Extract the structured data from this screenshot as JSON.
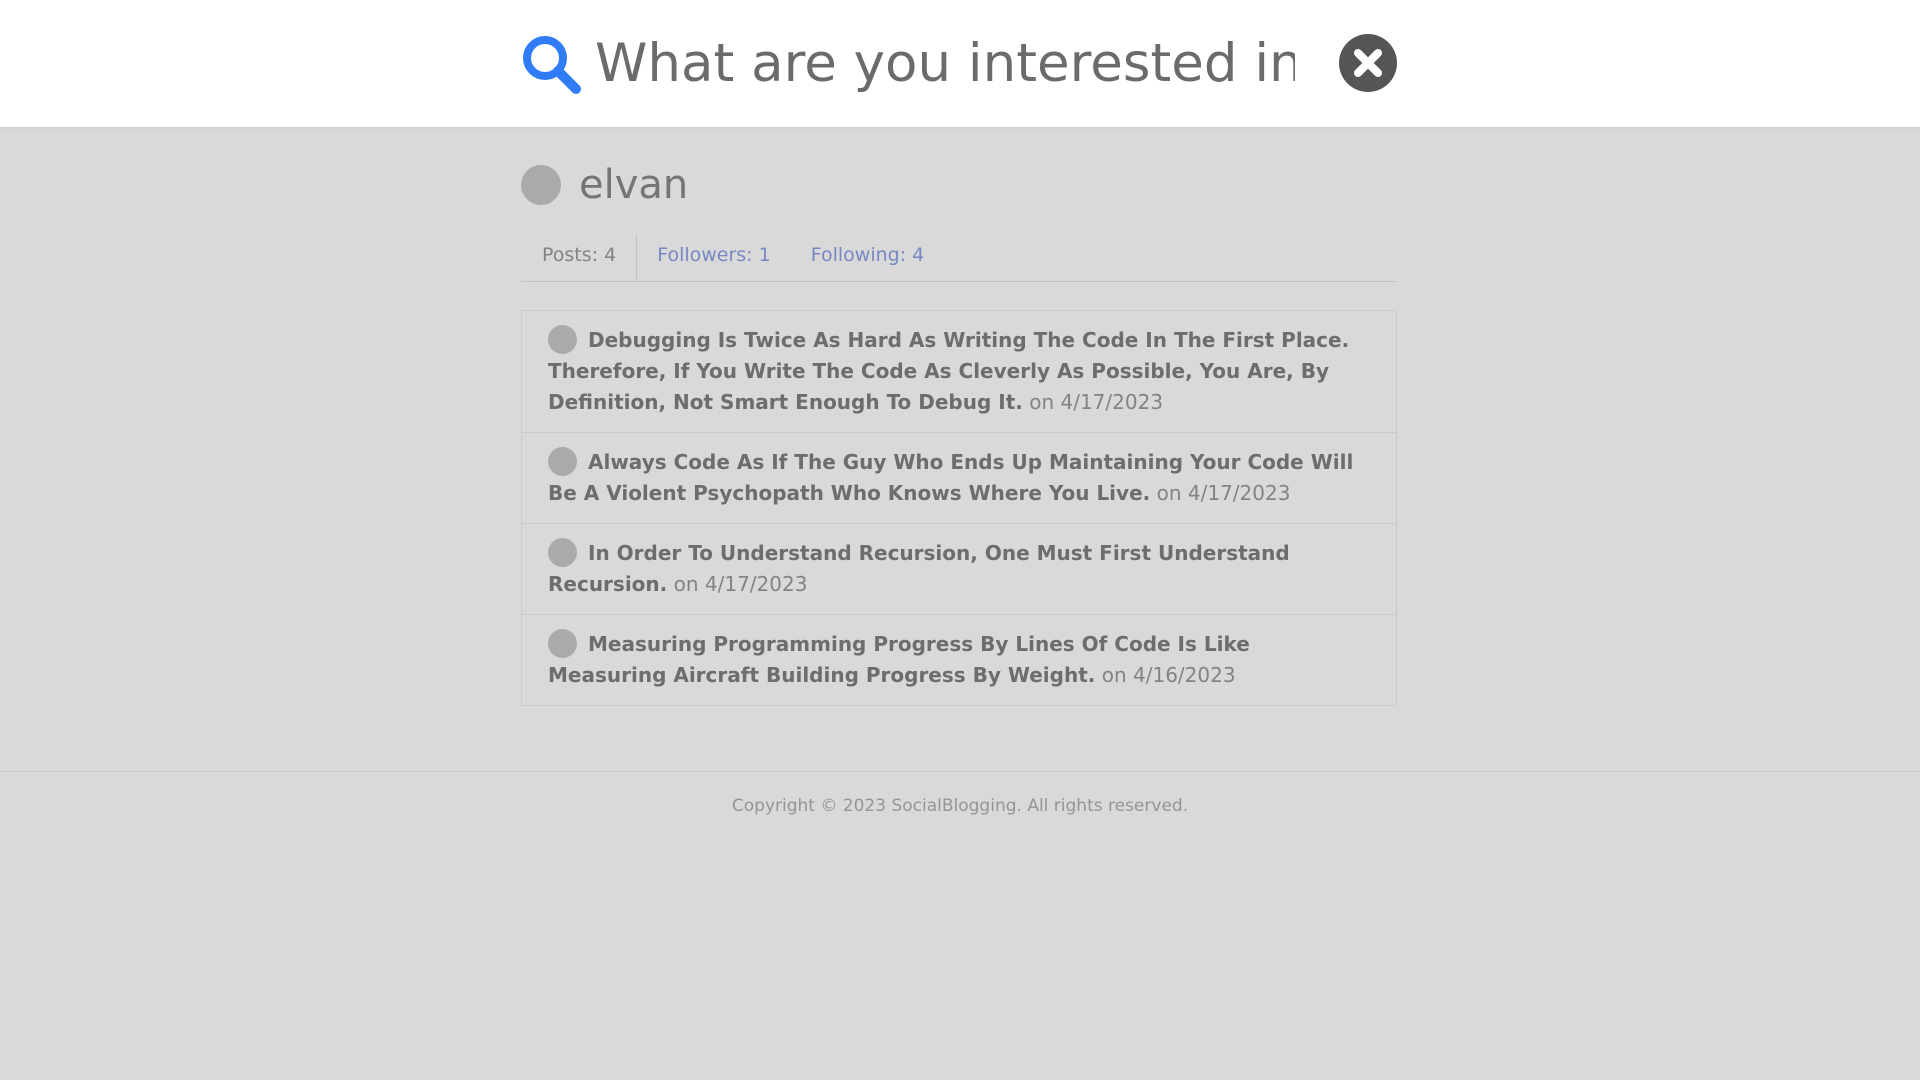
{
  "search": {
    "placeholder": "What are you interested in?"
  },
  "profile": {
    "username": "elvan",
    "stats": {
      "posts": "Posts: 4",
      "followers": "Followers: 1",
      "following": "Following: 4"
    }
  },
  "posts": [
    {
      "title": "Debugging Is Twice As Hard As Writing The Code In The First Place. Therefore, If You Write The Code As Cleverly As Possible, You Are, By Definition, Not Smart Enough To Debug It.",
      "date": "on 4/17/2023"
    },
    {
      "title": "Always Code As If The Guy Who Ends Up Maintaining Your Code Will Be A Violent Psychopath Who Knows Where You Live.",
      "date": "on 4/17/2023"
    },
    {
      "title": "In Order To Understand Recursion, One Must First Understand Recursion.",
      "date": "on 4/17/2023"
    },
    {
      "title": "Measuring Programming Progress By Lines Of Code Is Like Measuring Aircraft Building Progress By Weight.",
      "date": "on 4/16/2023"
    }
  ],
  "footer": {
    "copyright": "Copyright © 2023 SocialBlogging. All rights reserved."
  },
  "colors": {
    "search_icon": "#2f7cf6",
    "close_button": "#555555",
    "overlay": "rgba(0,0,0,0.15)"
  },
  "icons": {
    "search": "search-icon",
    "close": "close-icon"
  }
}
